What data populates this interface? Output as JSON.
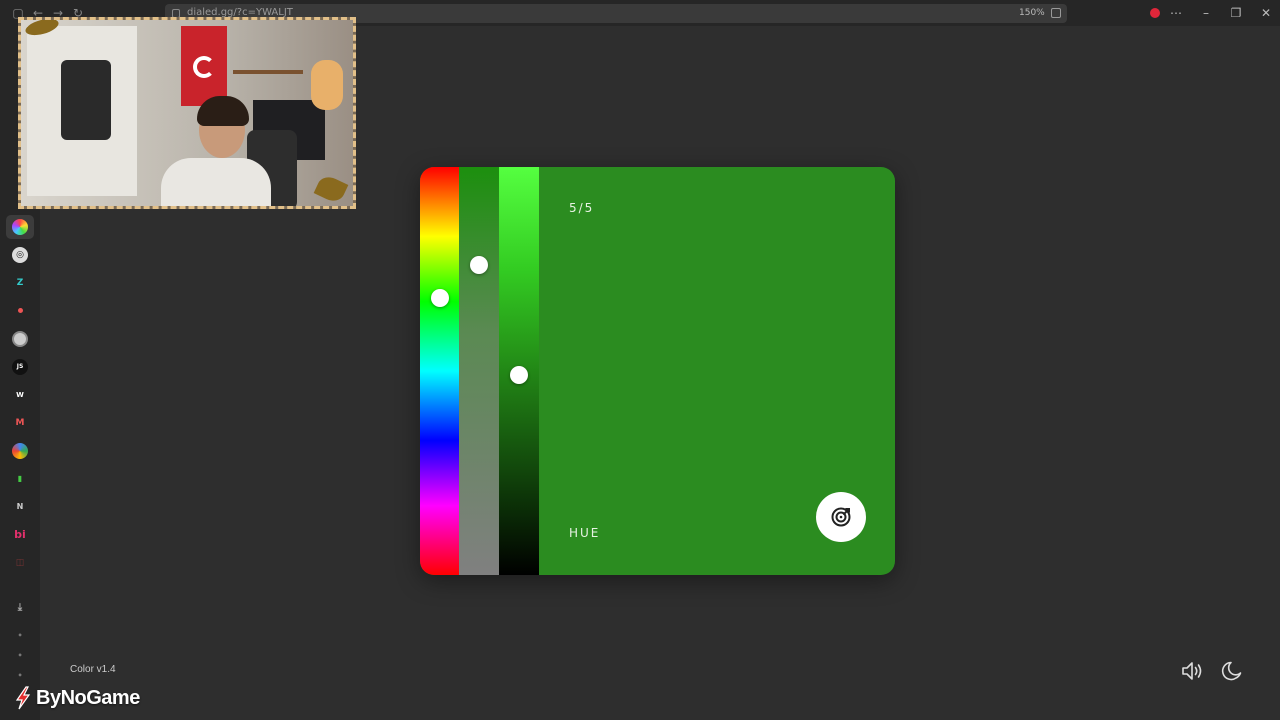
{
  "browser": {
    "url": "dialed.gg/?c=YWALJT",
    "zoom": "150%"
  },
  "game": {
    "round": "5/5",
    "mode_label": "HUE",
    "current_color": "#2b8c20",
    "hue_level": 0.32,
    "saturation_level": 0.24,
    "lightness_level": 0.51
  },
  "footer": {
    "version": "Color v1.4",
    "brand": "ByNoGame"
  },
  "icons": {
    "submit": "target-icon",
    "sound": "speaker-icon",
    "theme": "moon-icon"
  }
}
